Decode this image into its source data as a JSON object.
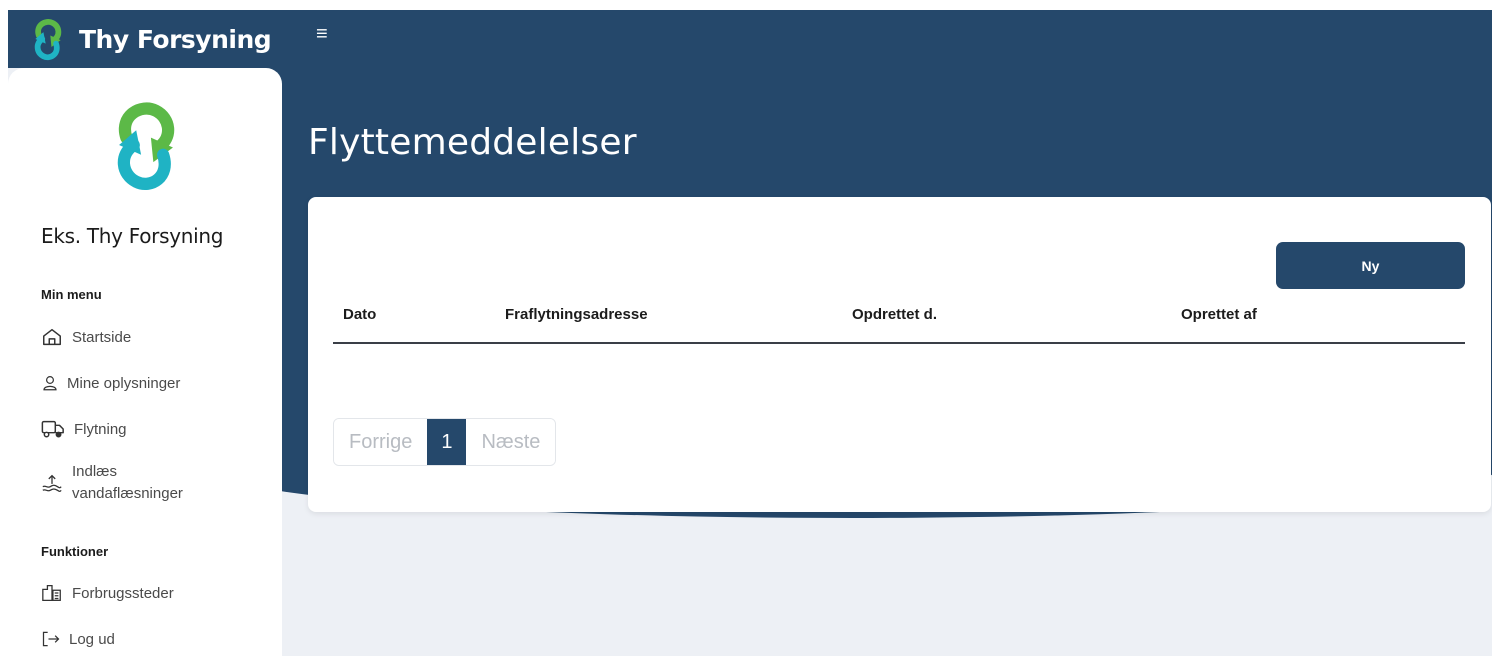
{
  "app": {
    "name": "Thy Forsyning"
  },
  "topbar": {
    "menu_icon": "hamburger-menu-icon"
  },
  "page": {
    "title": "Flyttemeddelelser"
  },
  "sidebar": {
    "company": "Eks. Thy Forsyning",
    "sections": [
      {
        "title": "Min menu"
      },
      {
        "title": "Funktioner"
      }
    ],
    "items": [
      {
        "label": "Startside",
        "icon": "home-icon"
      },
      {
        "label": "Mine oplysninger",
        "icon": "user-icon"
      },
      {
        "label": "Flytning",
        "icon": "truck-icon"
      },
      {
        "label_line1": "Indlæs",
        "label_line2": "vandaflæsninger",
        "icon": "water-upload-icon"
      },
      {
        "label": "Forbrugssteder",
        "icon": "buildings-icon"
      },
      {
        "label": "Log ud",
        "icon": "logout-icon"
      }
    ]
  },
  "card": {
    "new_button": "Ny",
    "table": {
      "columns": [
        "Dato",
        "Fraflytningsadresse",
        "Opdrettet d.",
        "Oprettet af"
      ],
      "rows": []
    },
    "pagination": {
      "prev": "Forrige",
      "current": "1",
      "next": "Næste"
    }
  },
  "colors": {
    "primary": "#25486b",
    "background": "#edf0f5",
    "logo_green": "#5cb947",
    "logo_teal": "#1fb3c4"
  }
}
